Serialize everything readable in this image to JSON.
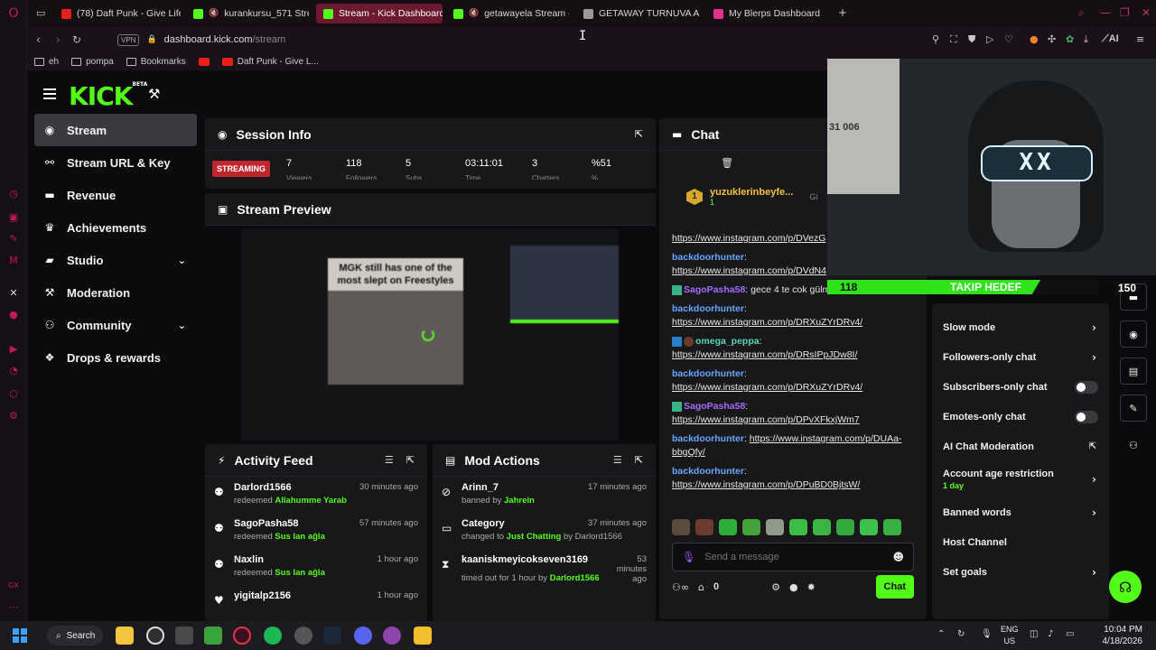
{
  "browser": {
    "tabs": [
      {
        "label": "(78) Daft Punk - Give Life",
        "fav_color": "#e62117"
      },
      {
        "label": "kurankursu_571 Stream",
        "fav_color": "#53fc18"
      },
      {
        "label": "Stream - Kick Dashboard",
        "fav_color": "#53fc18",
        "active": true
      },
      {
        "label": "getawayela Stream - V",
        "fav_color": "#53fc18"
      },
      {
        "label": "GETAWAY TURNUVA AG",
        "fav_color": "#9a9a9a"
      },
      {
        "label": "My Blerps Dashboard",
        "fav_color": "#e0338c"
      }
    ],
    "url_vpn": "VPN",
    "url_domain": "dashboard.kick.com",
    "url_path": "/stream",
    "bookmarks": [
      "eh",
      "pompa",
      "Bookmarks",
      "",
      "Daft Punk - Give L..."
    ],
    "ai_label": "AI"
  },
  "logo": {
    "text": "KICK",
    "beta": "BETA"
  },
  "sidebar": {
    "items": [
      {
        "label": "Stream",
        "icon": "broadcast-icon"
      },
      {
        "label": "Stream URL & Key",
        "icon": "link-icon"
      },
      {
        "label": "Revenue",
        "icon": "revenue-icon"
      },
      {
        "label": "Achievements",
        "icon": "trophy-icon"
      },
      {
        "label": "Studio",
        "icon": "studio-icon"
      },
      {
        "label": "Moderation",
        "icon": "hammer-icon"
      },
      {
        "label": "Community",
        "icon": "community-icon"
      },
      {
        "label": "Drops & rewards",
        "icon": "drops-icon"
      }
    ]
  },
  "session": {
    "title": "Session Info",
    "status": "STREAMING",
    "stats": [
      {
        "value": "7",
        "label": "Viewers"
      },
      {
        "value": "118",
        "label": "Followers"
      },
      {
        "value": "5",
        "label": "Subs"
      },
      {
        "value": "03:11:01",
        "label": "Time"
      },
      {
        "value": "3",
        "label": "Chatters"
      },
      {
        "value": "%51",
        "label": "%"
      }
    ]
  },
  "preview": {
    "title": "Stream Preview",
    "meme_caption": "MGK still has one of the most slept on Freestyles"
  },
  "activity": {
    "title": "Activity Feed",
    "items": [
      {
        "user": "Darlord1566",
        "action": "redeemed",
        "reward": "Allahumme Yarab",
        "time": "30 minutes ago"
      },
      {
        "user": "SagoPasha58",
        "action": "redeemed",
        "reward": "Sus lan ağla",
        "time": "57 minutes ago"
      },
      {
        "user": "Naxlin",
        "action": "redeemed",
        "reward": "Sus lan ağla",
        "time": "1 hour ago"
      },
      {
        "user": "yigitalp2156",
        "action": "",
        "reward": "",
        "time": "1 hour ago"
      }
    ]
  },
  "mod_actions": {
    "title": "Mod Actions",
    "items": [
      {
        "user": "Arinn_7",
        "pre": "banned by",
        "target": "Jahrein",
        "post": "",
        "time": "17 minutes ago"
      },
      {
        "user": "Category",
        "pre": "changed to",
        "target": "Just Chatting",
        "post": "by Darlord1566",
        "time": "37 minutes ago"
      },
      {
        "user": "kaaniskmeyicokseven3169",
        "pre": "timed out for 1 hour by",
        "target": "Darlord1566",
        "post": "",
        "time": "53 minutes ago"
      }
    ]
  },
  "chat": {
    "title": "Chat",
    "pinned_user": "yuzuklerinbeyfe...",
    "pinned_rank": "1",
    "pinned_sub": "1",
    "pinned_gift": "Gi",
    "messages": [
      {
        "user": "",
        "text": "https://www.instagram.com/p/DVezG",
        "style": "link"
      },
      {
        "user": "backdoorhunter",
        "text": "https://www.instagram.com/p/DVdN4",
        "style": "blue"
      },
      {
        "user": "SagoPasha58",
        "text": "gece 4 te cok gülmüştüm buna",
        "style": "purple-inline"
      },
      {
        "user": "backdoorhunter",
        "text": "https://www.instagram.com/p/DRXuZYrDRv4/",
        "style": "blue"
      },
      {
        "user": "omega_peppa",
        "text": "https://www.instagram.com/p/DRsIPpJDw8I/",
        "style": "teal"
      },
      {
        "user": "backdoorhunter",
        "text": "https://www.instagram.com/p/DRXuZYrDRv4/",
        "style": "blue"
      },
      {
        "user": "SagoPasha58",
        "text": "https://www.instagram.com/p/DPvXFkxjWm7",
        "style": "purple"
      },
      {
        "user": "backdoorhunter",
        "text": "https://www.instagram.com/p/DUAa-bbgQfy/",
        "style": "blue-inline"
      },
      {
        "user": "backdoorhunter",
        "text": "https://www.instagram.com/p/DPuBD0BjtsW/",
        "style": "blue"
      }
    ],
    "input_placeholder": "Send a message",
    "points": "0",
    "send_label": "Chat"
  },
  "settings": {
    "items": [
      {
        "label": "Slow mode",
        "kind": "chevron"
      },
      {
        "label": "Followers-only chat",
        "kind": "chevron"
      },
      {
        "label": "Subscribers-only chat",
        "kind": "toggle",
        "on": false
      },
      {
        "label": "Emotes-only chat",
        "kind": "toggle",
        "on": false
      },
      {
        "label": "AI Chat Moderation",
        "kind": "external"
      },
      {
        "label": "Account age restriction",
        "sub": "1 day",
        "kind": "chevron"
      },
      {
        "label": "Banned words",
        "kind": "chevron"
      },
      {
        "label": "Host Channel",
        "kind": "none"
      },
      {
        "label": "Set goals",
        "kind": "chevron"
      }
    ]
  },
  "overlay": {
    "follow_count": "118",
    "follow_label": "TAKIP HEDEF",
    "follow_goal": "150",
    "follow_progress": 0.787,
    "webcam_note": "31 006"
  },
  "taskbar": {
    "search": "Search",
    "lang_top": "ENG",
    "lang_bottom": "US",
    "time": "10:04 PM",
    "date": "4/18/2026"
  },
  "colors": {
    "accent": "#53fc18",
    "live": "#c0262d",
    "tab_active": "#6b1830"
  }
}
